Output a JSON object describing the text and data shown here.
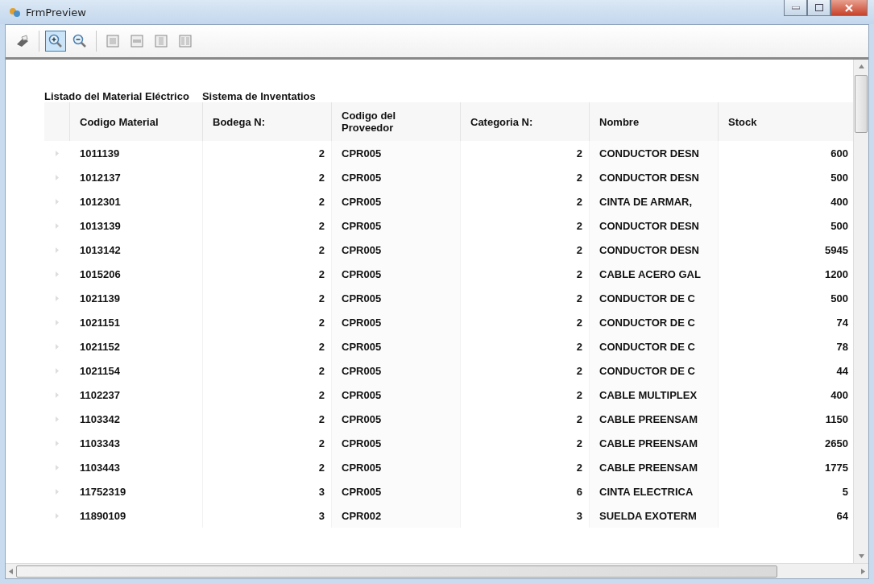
{
  "window": {
    "title": "FrmPreview"
  },
  "toolbar": [
    {
      "kind": "print",
      "selected": false
    },
    {
      "kind": "zoom-in",
      "selected": true
    },
    {
      "kind": "zoom-out",
      "selected": false
    },
    {
      "kind": "fit-page",
      "selected": false
    },
    {
      "kind": "fit-width",
      "selected": false
    },
    {
      "kind": "one-page",
      "selected": false
    },
    {
      "kind": "two-pages",
      "selected": false
    }
  ],
  "report": {
    "title": "Listado del Material Eléctrico",
    "subtitle": "Sistema de Inventatios"
  },
  "table": {
    "columns": [
      "Codigo Material",
      "Bodega N:",
      "Codigo del Proveedor",
      "Categoria N:",
      "Nombre",
      "Stock"
    ],
    "rows": [
      [
        "1011139",
        "2",
        "CPR005",
        "2",
        "CONDUCTOR DESN",
        "600"
      ],
      [
        "1012137",
        "2",
        "CPR005",
        "2",
        "CONDUCTOR DESN",
        "500"
      ],
      [
        "1012301",
        "2",
        "CPR005",
        "2",
        "CINTA DE ARMAR,",
        "400"
      ],
      [
        "1013139",
        "2",
        "CPR005",
        "2",
        "CONDUCTOR DESN",
        "500"
      ],
      [
        "1013142",
        "2",
        "CPR005",
        "2",
        "CONDUCTOR DESN",
        "5945"
      ],
      [
        "1015206",
        "2",
        "CPR005",
        "2",
        "CABLE ACERO GAL",
        "1200"
      ],
      [
        "1021139",
        "2",
        "CPR005",
        "2",
        "CONDUCTOR DE C",
        "500"
      ],
      [
        "1021151",
        "2",
        "CPR005",
        "2",
        "CONDUCTOR DE C",
        "74"
      ],
      [
        "1021152",
        "2",
        "CPR005",
        "2",
        "CONDUCTOR DE C",
        "78"
      ],
      [
        "1021154",
        "2",
        "CPR005",
        "2",
        "CONDUCTOR DE C",
        "44"
      ],
      [
        "1102237",
        "2",
        "CPR005",
        "2",
        "CABLE MULTIPLEX",
        "400"
      ],
      [
        "1103342",
        "2",
        "CPR005",
        "2",
        "CABLE PREENSAM",
        "1150"
      ],
      [
        "1103343",
        "2",
        "CPR005",
        "2",
        "CABLE PREENSAM",
        "2650"
      ],
      [
        "1103443",
        "2",
        "CPR005",
        "2",
        "CABLE PREENSAM",
        "1775"
      ],
      [
        "11752319",
        "3",
        "CPR005",
        "6",
        "CINTA ELECTRICA",
        "5"
      ],
      [
        "11890109",
        "3",
        "CPR002",
        "3",
        "SUELDA EXOTERM",
        "64"
      ]
    ]
  }
}
